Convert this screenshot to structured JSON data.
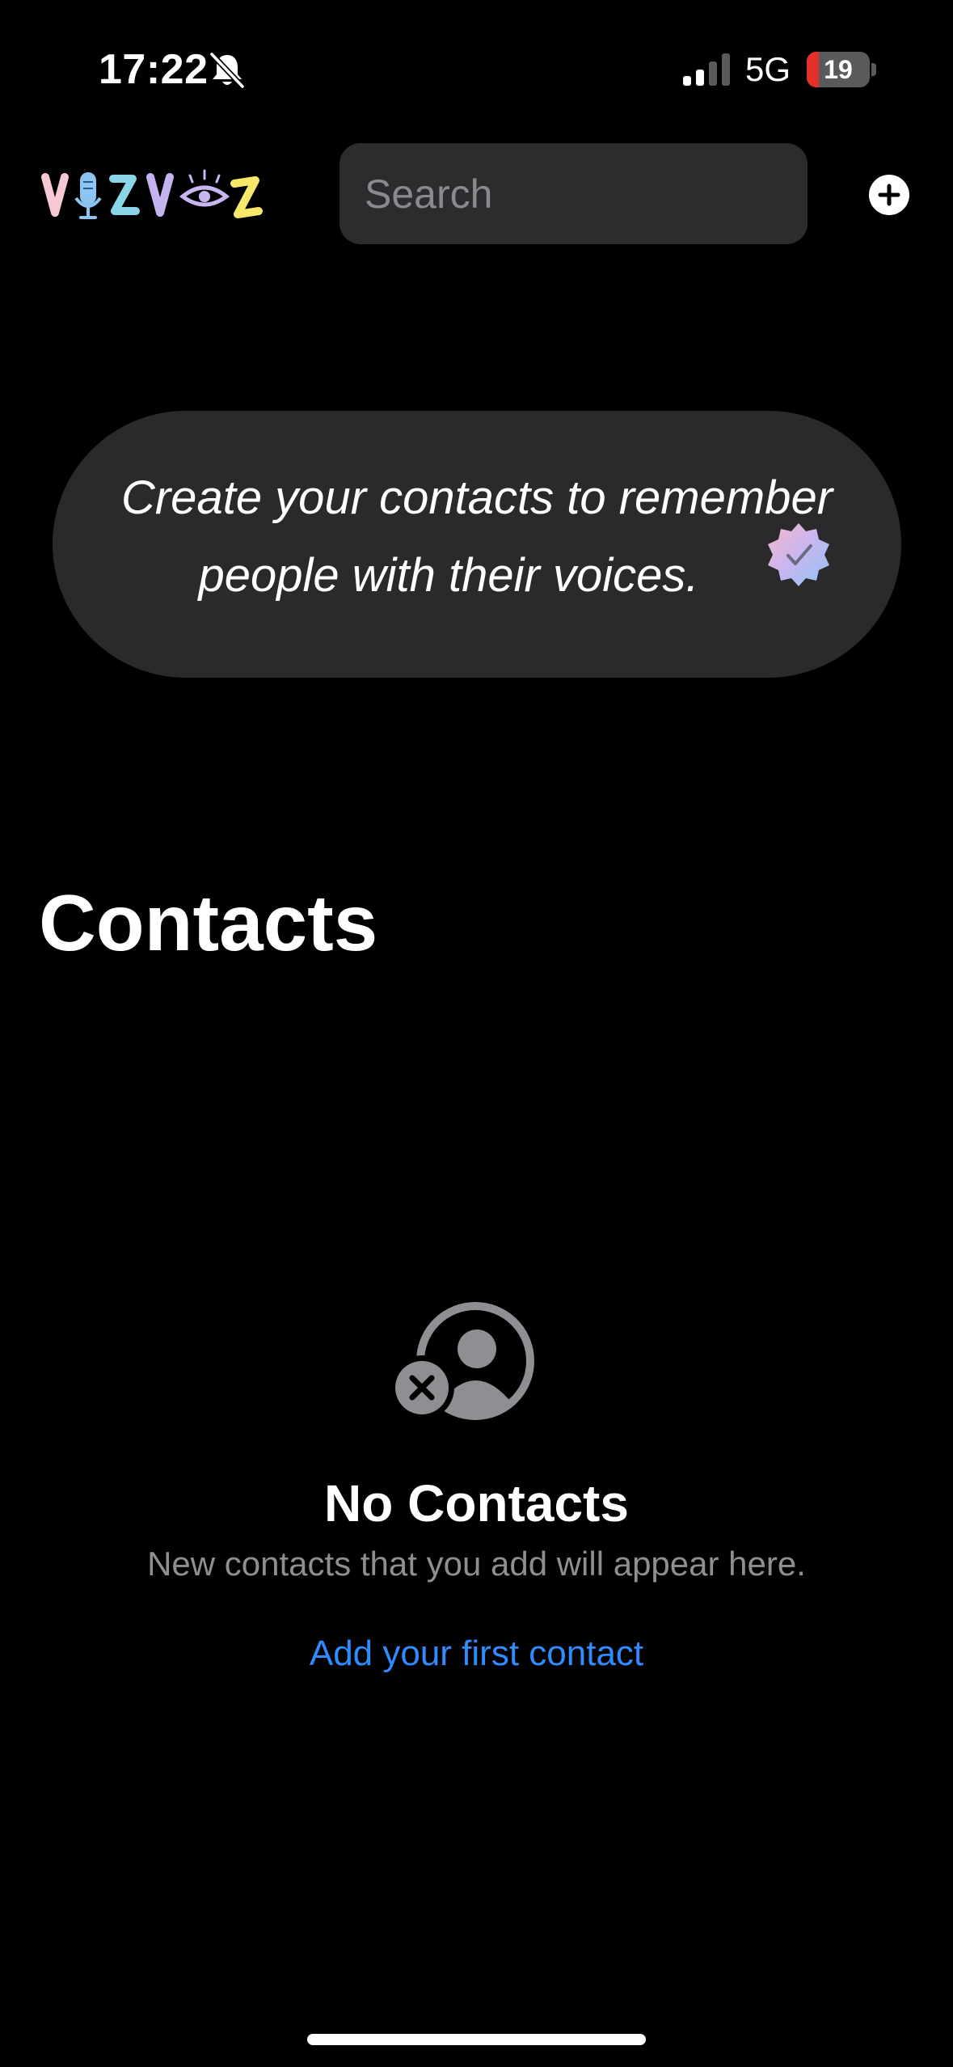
{
  "status_bar": {
    "time": "17:22",
    "network": "5G",
    "battery_level": "19",
    "battery_percent": 19,
    "icons": [
      "bell-slash-icon",
      "cellular-signal-icon",
      "battery-icon"
    ]
  },
  "header": {
    "logo_text": "VOZVOZ",
    "search": {
      "placeholder": "Search",
      "value": ""
    },
    "add_icon": "plus-circle-icon"
  },
  "banner": {
    "line1": "Create your contacts to remember",
    "line2": "people with their voices.",
    "badge_icon": "verified-badge-icon"
  },
  "page": {
    "title": "Contacts"
  },
  "empty_state": {
    "icon": "person-circle-xmark-icon",
    "title": "No Contacts",
    "subtitle": "New contacts that you add will appear here.",
    "link": "Add your first contact"
  },
  "colors": {
    "background": "#000000",
    "surface": "#2c2c2e",
    "secondary_text": "#8e8e93",
    "link": "#2f8cff",
    "battery_low": "#e5302c"
  }
}
